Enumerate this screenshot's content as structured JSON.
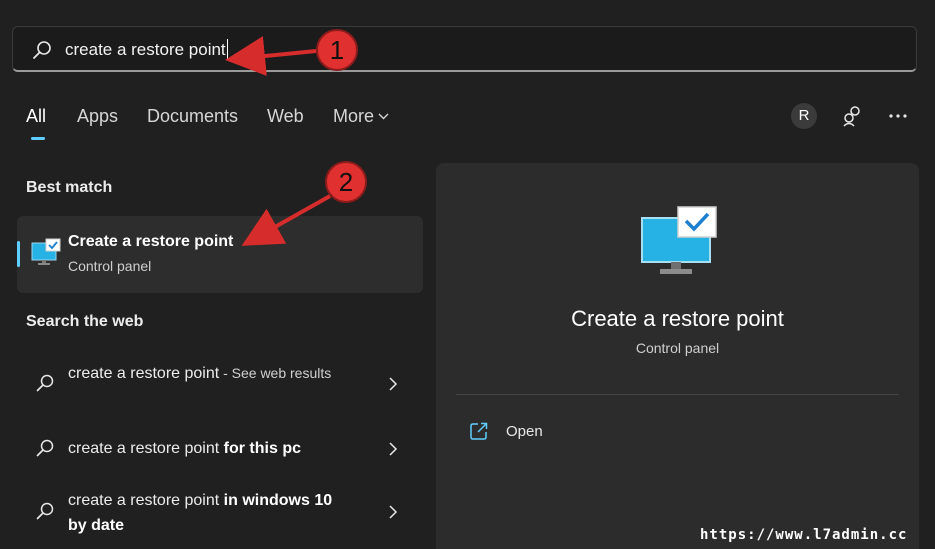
{
  "search": {
    "query": "create a restore point"
  },
  "tabs": [
    {
      "label": "All"
    },
    {
      "label": "Apps"
    },
    {
      "label": "Documents"
    },
    {
      "label": "Web"
    },
    {
      "label": "More"
    }
  ],
  "header_actions": {
    "avatar_initial": "R",
    "share_icon": "share-icon",
    "more_icon": "more-options-icon"
  },
  "best_match": {
    "heading": "Best match",
    "item": {
      "title": "Create a restore point",
      "subtitle": "Control panel",
      "icon": "system-properties-icon"
    }
  },
  "web": {
    "heading": "Search the web",
    "items": [
      {
        "query": "create a restore point",
        "suffix": "",
        "hint": " - See web results"
      },
      {
        "query": "create a restore point",
        "suffix": " for this pc",
        "hint": ""
      },
      {
        "query": "create a restore point",
        "suffix": " in windows 10 by date",
        "hint": ""
      }
    ]
  },
  "preview": {
    "title": "Create a restore point",
    "subtitle": "Control panel",
    "actions": [
      {
        "label": "Open",
        "icon": "open-external-icon"
      }
    ]
  },
  "annotations": [
    {
      "label": "1"
    },
    {
      "label": "2"
    }
  ],
  "watermark": "https://www.l7admin.cc",
  "colors": {
    "accent": "#60cdff",
    "background": "#202020",
    "panel": "#2c2c2c",
    "annotation_red": "#e03030"
  }
}
